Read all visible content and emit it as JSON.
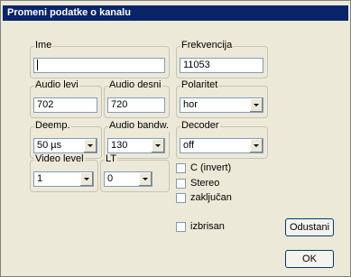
{
  "window": {
    "title": "Promeni podatke o kanalu"
  },
  "fields": {
    "ime": {
      "label": "Ime",
      "value": ""
    },
    "frekvencija": {
      "label": "Frekvencija",
      "value": "11053"
    },
    "audio_levi": {
      "label": "Audio levi",
      "value": "702"
    },
    "audio_desni": {
      "label": "Audio desni",
      "value": "720"
    },
    "polaritet": {
      "label": "Polaritet",
      "value": "hor"
    },
    "deemp": {
      "label": "Deemp.",
      "value": "50 µs"
    },
    "audio_bandw": {
      "label": "Audio bandw.",
      "value": "130"
    },
    "decoder": {
      "label": "Decoder",
      "value": "off"
    },
    "video_level": {
      "label": "Video level",
      "value": "1"
    },
    "lt": {
      "label": "LT",
      "value": "0"
    }
  },
  "checkboxes": {
    "c_invert": {
      "label": "C (invert)",
      "checked": false
    },
    "stereo": {
      "label": "Stereo",
      "checked": false
    },
    "zakljucan": {
      "label": "zaključan",
      "checked": false
    },
    "izbrisan": {
      "label": "izbrisan",
      "checked": false
    }
  },
  "buttons": {
    "cancel": "Odustani",
    "ok": "OK"
  }
}
